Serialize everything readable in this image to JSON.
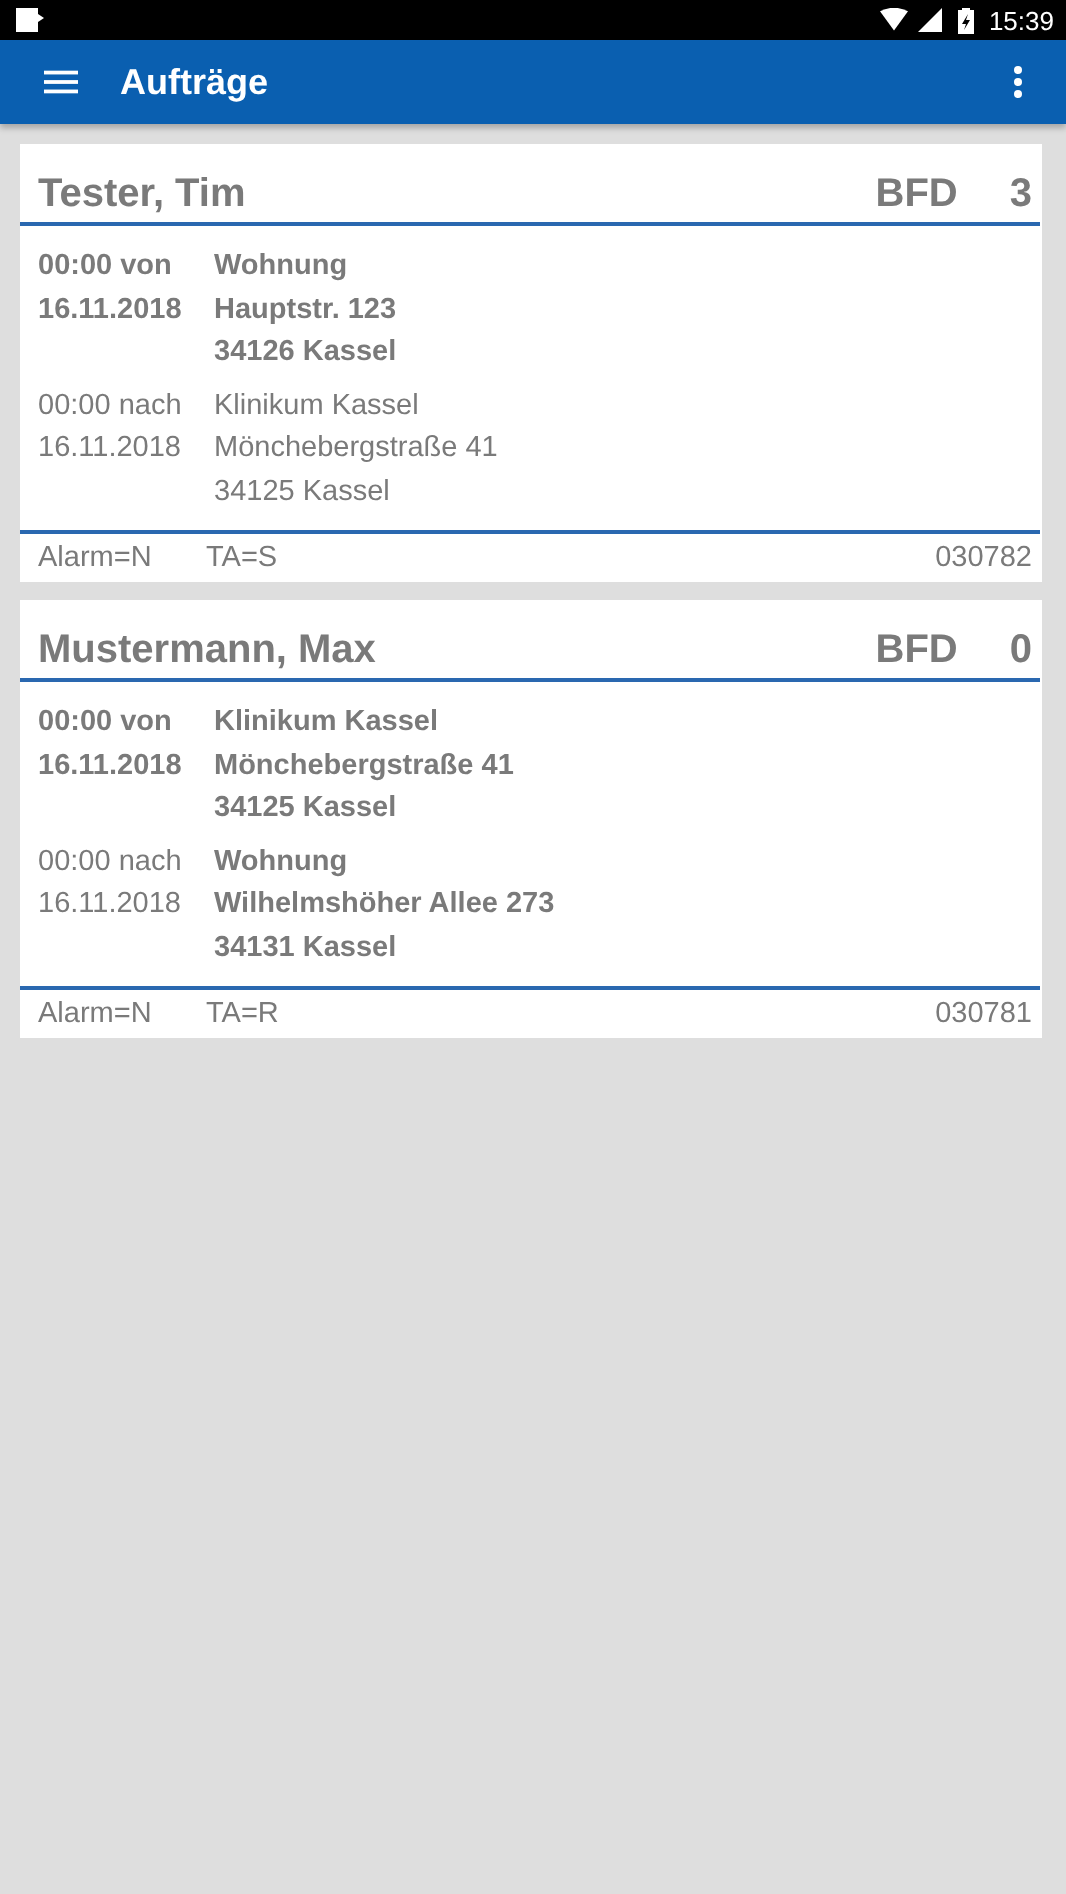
{
  "status_bar": {
    "time": "15:39"
  },
  "app_bar": {
    "title": "Aufträge"
  },
  "orders": [
    {
      "name": "Tester, Tim",
      "unit": "BFD",
      "count": "3",
      "stops": [
        {
          "time": "00:00 von",
          "date": "16.11.2018",
          "address": [
            "Wohnung",
            "Hauptstr. 123",
            "34126 Kassel"
          ],
          "label_bold": true,
          "address_bold": true
        },
        {
          "time": "00:00 nach",
          "date": "16.11.2018",
          "address": [
            "Klinikum Kassel",
            "Mönchebergstraße 41",
            "34125 Kassel"
          ],
          "label_bold": false,
          "address_bold": false
        }
      ],
      "alarm": "Alarm=N",
      "ta": "TA=S",
      "number": "030782"
    },
    {
      "name": "Mustermann, Max",
      "unit": "BFD",
      "count": "0",
      "stops": [
        {
          "time": "00:00 von",
          "date": "16.11.2018",
          "address": [
            "Klinikum Kassel",
            "Mönchebergstraße 41",
            "34125 Kassel"
          ],
          "label_bold": true,
          "address_bold": true
        },
        {
          "time": "00:00 nach",
          "date": "16.11.2018",
          "address": [
            "Wohnung",
            "Wilhelmshöher Allee 273",
            "34131 Kassel"
          ],
          "label_bold": false,
          "address_bold": true
        }
      ],
      "alarm": "Alarm=N",
      "ta": "TA=R",
      "number": "030781"
    }
  ]
}
